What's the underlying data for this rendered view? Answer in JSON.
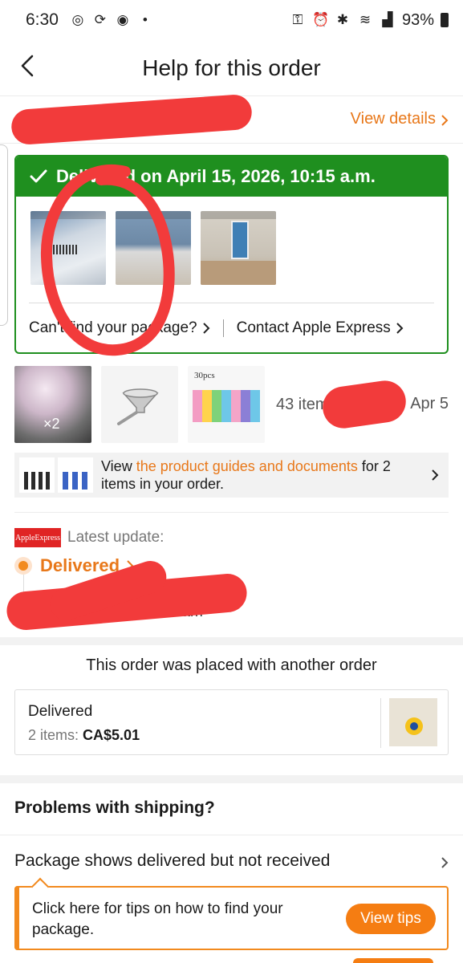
{
  "status_bar": {
    "time": "6:30",
    "battery": "93%"
  },
  "header": {
    "title": "Help for this order"
  },
  "order": {
    "view_details": "View details"
  },
  "delivery": {
    "headline": "Delivered on April 15, 2026, 10:15 a.m.",
    "links": {
      "cant_find": "Can't find your package?",
      "contact": "Contact Apple Express"
    }
  },
  "items": {
    "qty_badge": "×2",
    "thumb_tag": "30pcs",
    "summary": "43 items: C",
    "date_fragment": "Apr 5"
  },
  "guides": {
    "prefix": "View ",
    "link": "the product guides and documents",
    "suffix": " for 2 items in your order."
  },
  "tracking": {
    "carrier_logo": "AppleExpress",
    "latest_label": "Latest update:",
    "status": "Delivered",
    "time_fragment": "15 am"
  },
  "combined_order": {
    "title": "This order was placed with another order",
    "status": "Delivered",
    "count_label": "2 items: ",
    "price": "CA$5.01"
  },
  "problems": {
    "title": "Problems with shipping?",
    "row_label": "Package shows delivered but not received",
    "tip_text": "Click here for tips on how to find your package.",
    "tip_button": "View tips"
  },
  "colors": {
    "accent_orange": "#e8781a",
    "delivered_green": "#1f8f1f",
    "annotation_red": "#f23b3b"
  }
}
